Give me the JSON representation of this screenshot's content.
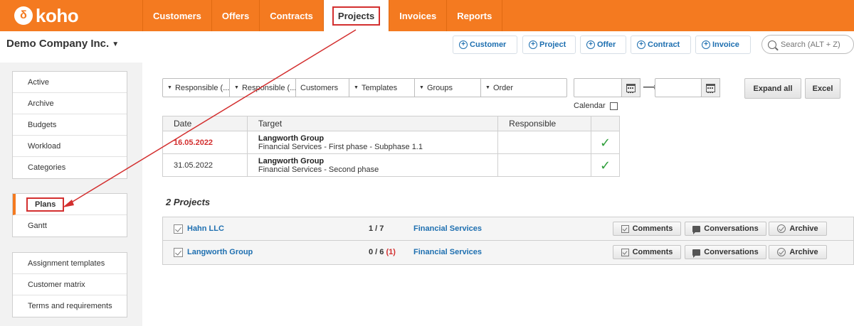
{
  "app": {
    "logo_text": "koho",
    "logo_mark": "δ"
  },
  "nav": {
    "items": [
      {
        "label": "Customers",
        "active": false
      },
      {
        "label": "Offers",
        "active": false
      },
      {
        "label": "Contracts",
        "active": false
      },
      {
        "label": "Projects",
        "active": true
      },
      {
        "label": "Invoices",
        "active": false
      },
      {
        "label": "Reports",
        "active": false
      }
    ]
  },
  "header": {
    "company": "Demo Company Inc.",
    "quick_actions": [
      "Customer",
      "Project",
      "Offer",
      "Contract",
      "Invoice"
    ],
    "search_placeholder": "Search (ALT + Z)"
  },
  "sidebar": {
    "group1": [
      "Active",
      "Archive",
      "Budgets",
      "Workload",
      "Categories"
    ],
    "group2": [
      "Plans",
      "Gantt"
    ],
    "group3": [
      "Assignment templates",
      "Customer matrix",
      "Terms and requirements"
    ],
    "active": "Plans"
  },
  "filters": {
    "items": [
      "Responsible (...",
      "Responsible (...",
      "Customers",
      "Templates",
      "Groups",
      "Order"
    ],
    "dropdown_flags": [
      true,
      true,
      false,
      true,
      true,
      true
    ],
    "expand_all": "Expand all",
    "excel": "Excel",
    "calendar_label": "Calendar",
    "calendar_checked": false
  },
  "plans_table": {
    "headers": [
      "Date",
      "Target",
      "Responsible",
      ""
    ],
    "rows": [
      {
        "date": "16.05.2022",
        "overdue": true,
        "target_name": "Langworth Group",
        "target_sub": "Financial Services - First phase - Subphase 1.1",
        "responsible": "",
        "done": "✓"
      },
      {
        "date": "31.05.2022",
        "overdue": false,
        "target_name": "Langworth Group",
        "target_sub": "Financial Services - Second phase",
        "responsible": "",
        "done": "✓"
      }
    ]
  },
  "projects": {
    "heading": "2 Projects",
    "rows": [
      {
        "name": "Hahn LLC",
        "count": "1 / 7",
        "extra": "",
        "category": "Financial Services"
      },
      {
        "name": "Langworth Group",
        "count": "0 / 6 ",
        "extra": "(1)",
        "category": "Financial Services"
      }
    ],
    "buttons": [
      "Comments",
      "Conversations",
      "Archive"
    ]
  },
  "colors": {
    "brand": "#f47a20",
    "link": "#1e6fb0",
    "annotation": "#d32f2f",
    "check": "#2e9e3a"
  }
}
